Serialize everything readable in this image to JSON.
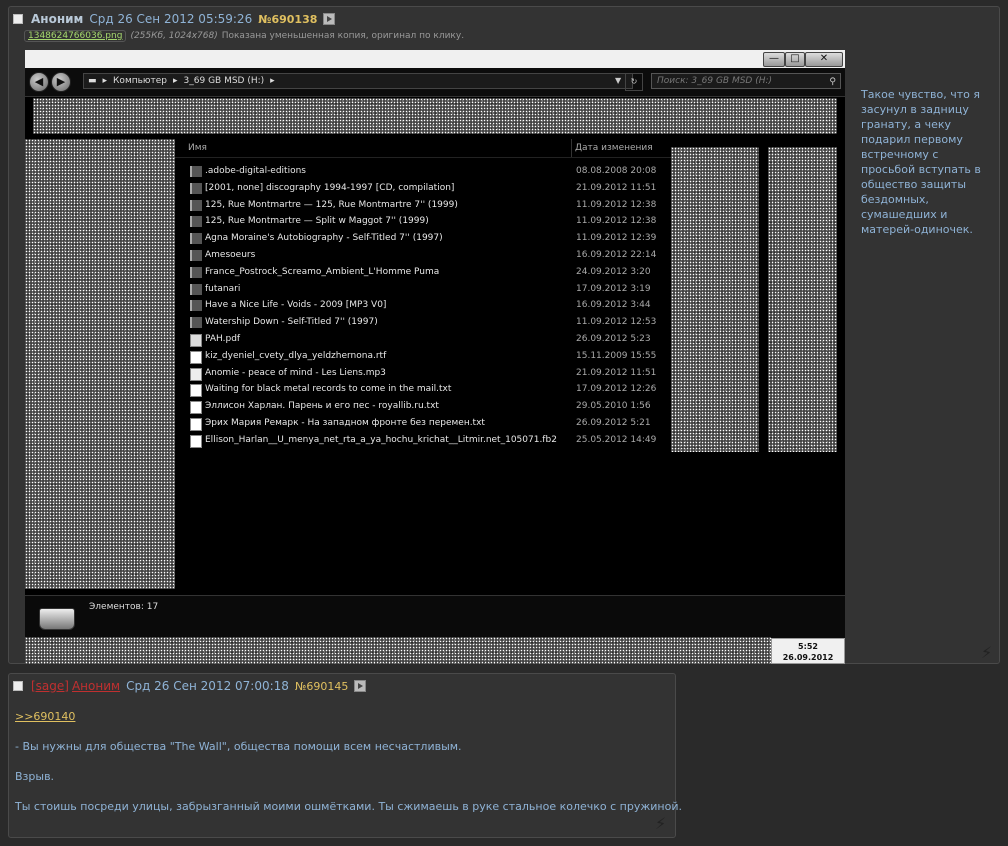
{
  "post1": {
    "author": "Аноним",
    "date": "Срд 26 Сен 2012 05:59:26",
    "number": "№690138",
    "file": {
      "name": "1348624766036.png",
      "meta": "(255Кб, 1024x768)",
      "note": "Показана уменьшенная копия, оригинал по клику."
    },
    "text": "Такое чувство, что я засунул в задницу гранату, а чеку подарил первому встречному с просьбой вступать в общество защиты бездомных, сумашедших и матерей-одиночек."
  },
  "screenshot": {
    "window_controls": {
      "minimize": "—",
      "maximize": "□",
      "close": "✕"
    },
    "address_path": [
      "Компьютер",
      "3_69 GB MSD (H:)"
    ],
    "search_placeholder": "Поиск: 3_69 GB MSD (H:)",
    "columns": {
      "name": "Имя",
      "date": "Дата изменения"
    },
    "files": [
      {
        "name": ".adobe-digital-editions",
        "date": "08.08.2008 20:08",
        "type": "folder"
      },
      {
        "name": "[2001, none] discography 1994-1997 [CD, compilation]",
        "date": "21.09.2012 11:51",
        "type": "folder"
      },
      {
        "name": "125, Rue Montmartre — 125, Rue Montmartre 7'' (1999)",
        "date": "11.09.2012 12:38",
        "type": "folder"
      },
      {
        "name": "125, Rue Montmartre — Split w Maggot 7'' (1999)",
        "date": "11.09.2012 12:38",
        "type": "folder"
      },
      {
        "name": "Agna Moraine's Autobiography - Self-Titled 7'' (1997)",
        "date": "11.09.2012 12:39",
        "type": "folder"
      },
      {
        "name": "Amesoeurs",
        "date": "16.09.2012 22:14",
        "type": "folder"
      },
      {
        "name": "France_Postrock_Screamo_Ambient_L'Homme Puma",
        "date": "24.09.2012 3:20",
        "type": "folder"
      },
      {
        "name": "futanari",
        "date": "17.09.2012 3:19",
        "type": "folder"
      },
      {
        "name": "Have a Nice Life - Voids - 2009 [MP3 V0]",
        "date": "16.09.2012 3:44",
        "type": "folder"
      },
      {
        "name": "Watership Down - Self-Titled 7'' (1997)",
        "date": "11.09.2012 12:53",
        "type": "folder"
      },
      {
        "name": "PAH.pdf",
        "date": "26.09.2012 5:23",
        "type": "pdf"
      },
      {
        "name": "kiz_dyeniel_cvety_dlya_yeldzhernona.rtf",
        "date": "15.11.2009 15:55",
        "type": "rtf"
      },
      {
        "name": "Anomie - peace of mind - Les Liens.mp3",
        "date": "21.09.2012 11:51",
        "type": "mp3"
      },
      {
        "name": "Waiting for black metal records to come in the mail.txt",
        "date": "17.09.2012 12:26",
        "type": "txt"
      },
      {
        "name": "Эллисон Харлан. Парень и его пес - royallib.ru.txt",
        "date": "29.05.2010 1:56",
        "type": "txt"
      },
      {
        "name": "Эрих Мария Ремарк - На западном фронте без перемен.txt",
        "date": "26.09.2012 5:21",
        "type": "txt"
      },
      {
        "name": "Ellison_Harlan__U_menya_net_rta_a_ya_hochu_krichat__Litmir.net_105071.fb2",
        "date": "25.05.2012 14:49",
        "type": "fb2"
      }
    ],
    "status": "Элементов: 17",
    "clock_time": "5:52",
    "clock_date": "26.09.2012"
  },
  "post2": {
    "sage": "[sage]",
    "author": "Аноним",
    "date": "Срд 26 Сен 2012 07:00:18",
    "number": "№690145",
    "reply": ">>690140",
    "lines": [
      "- Вы нужны для общества \"The Wall\", общества помощи всем несчастливым.",
      "Взрыв.",
      "Ты стоишь посреди улицы, забрызганный моими ошмётками. Ты сжимаешь в руке стальное колечко с пружиной."
    ]
  }
}
